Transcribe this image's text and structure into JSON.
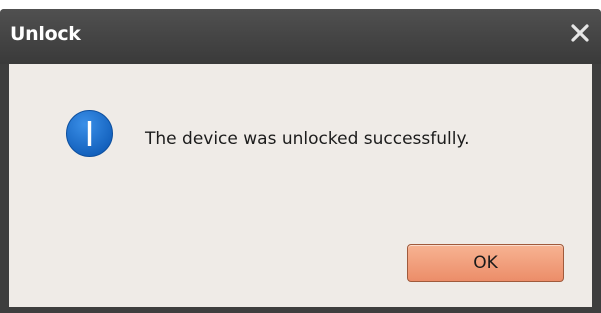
{
  "window": {
    "title": "Unlock",
    "close_icon": "close-icon"
  },
  "message": {
    "icon": "info-icon",
    "text": "The device was unlocked successfully."
  },
  "buttons": {
    "ok_label": "OK"
  },
  "colors": {
    "titlebar": "#3e3e3e",
    "content_background": "#efebe7",
    "info_icon": "#1c6fce",
    "ok_button": "#ef9575"
  }
}
